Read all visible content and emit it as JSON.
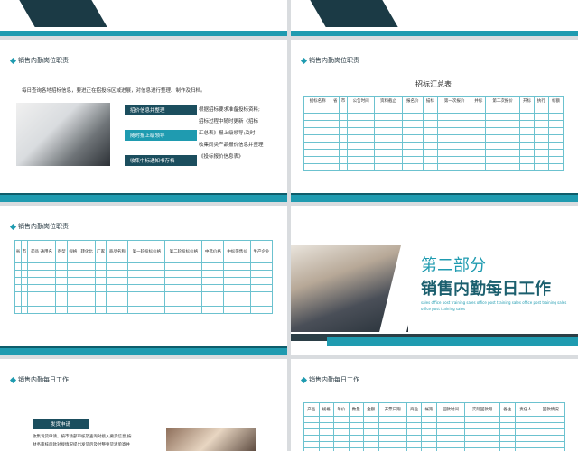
{
  "slide1": {
    "title": "销售内勤岗位职责",
    "intro": "每日查询各地招标信息，要进正在招投标区域进展，对信息进行整理、制作及扫档。",
    "tags": [
      "招价信息并整理",
      "随时报上级领导",
      "收集中标通知书存档"
    ],
    "lines": [
      "根据招标要求准备投标资料;",
      "招标过程中随时更新《招标",
      "汇总表》报上级领导;及时",
      "收集同类产品报价信息并整理",
      "《投标报价信息表》"
    ]
  },
  "slide2": {
    "title": "销售内勤岗位职责",
    "table_title": "招标汇总表",
    "headers": [
      "招标名称",
      "省",
      "市",
      "公告时间",
      "资料截止",
      "报名价",
      "描标",
      "第一次报价",
      "并标",
      "第二次报价",
      "开标",
      "执行",
      "标额"
    ]
  },
  "slide3": {
    "title": "销售内勤岗位职责",
    "headers": [
      "省",
      "市",
      "药品 通用名",
      "剂型",
      "规格",
      "转化比",
      "厂家",
      "商品名称",
      "第一轮投标价格",
      "第二轮投标价格",
      "中选价格",
      "中标带售价",
      "生产企业"
    ]
  },
  "slide4": {
    "part": "第二部分",
    "heading": "销售内勤每日工作",
    "sub": "sales office post training sales office post training sales office post training sales office post training sales"
  },
  "slide5": {
    "title": "销售内勤每日工作",
    "tag": "发货申请",
    "lines": [
      "收集发货申请，按市场部审核及查询对接入要货信息,按",
      "财务审核后款对接情况提出发货后及时整要货清单寄并"
    ]
  },
  "slide6": {
    "title": "销售内勤每日工作",
    "headers": [
      "产品",
      "规格",
      "单价",
      "数量",
      "金额",
      "开票日期",
      "商业",
      "帐期",
      "回款时间",
      "实际回款月",
      "备注",
      "责任人",
      "回款情况"
    ]
  }
}
